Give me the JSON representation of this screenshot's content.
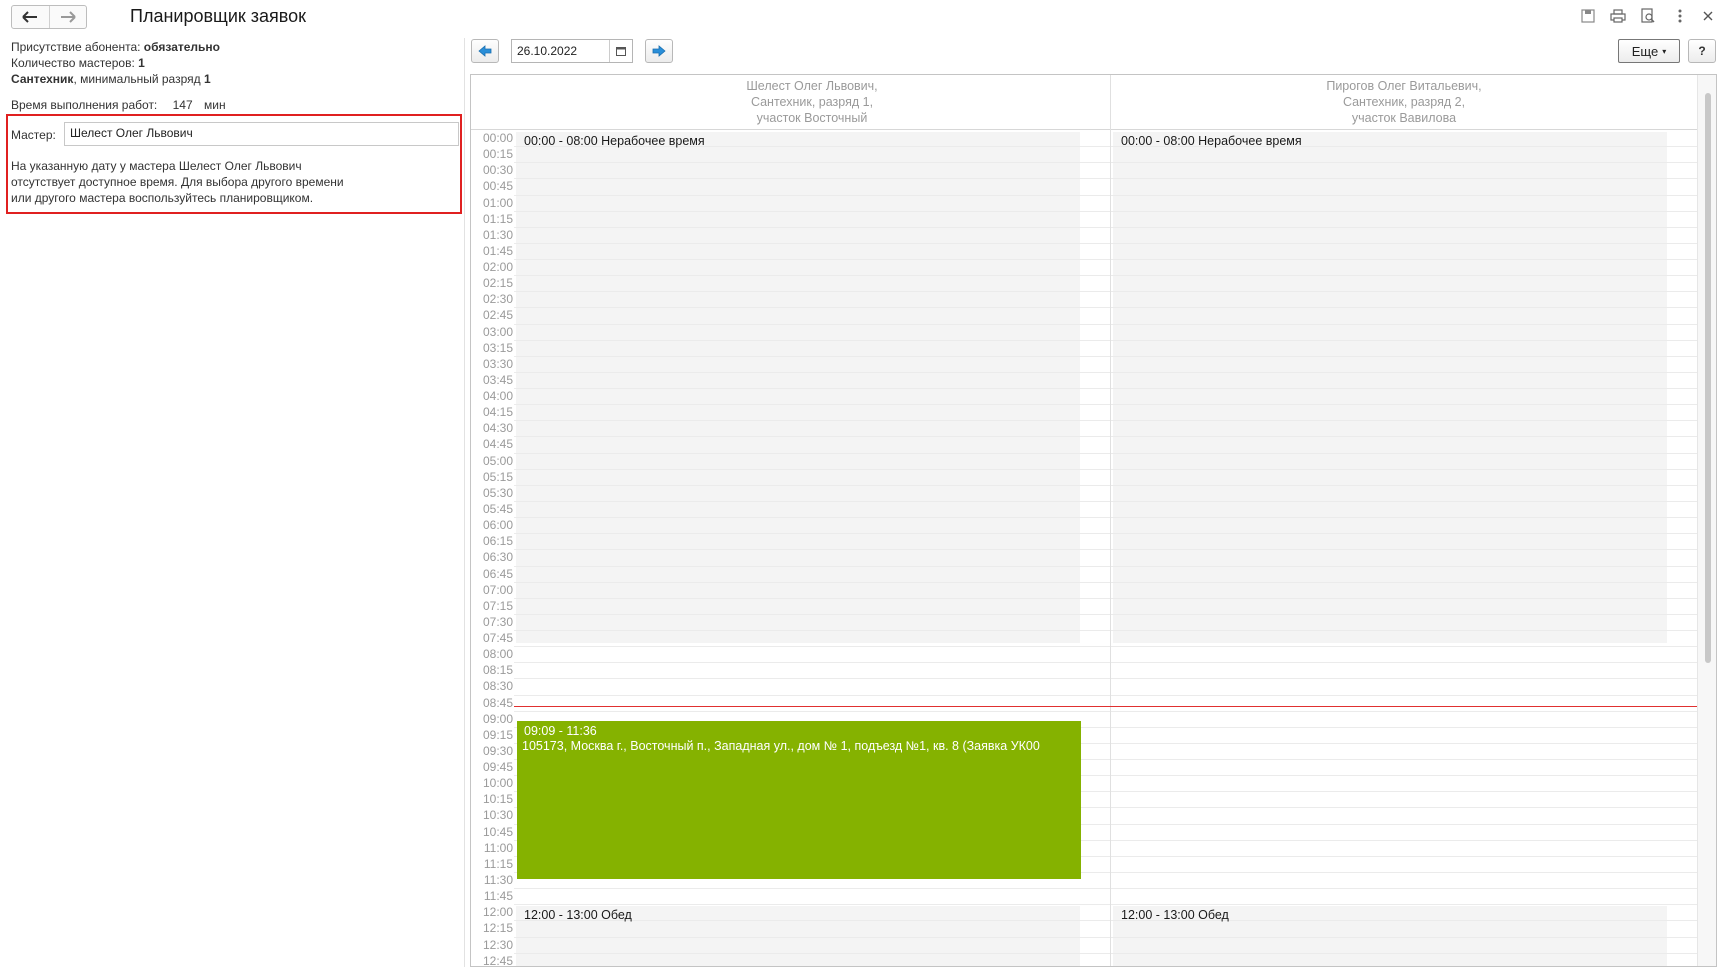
{
  "window": {
    "title": "Планировщик заявок"
  },
  "info": {
    "presence_label": "Присутствие абонента: ",
    "presence_value": "обязательно",
    "masters_count_label": "Количество мастеров: ",
    "masters_count_value": "1",
    "specialty_value": "Сантехник",
    "specialty_rest": ", минимальный разряд ",
    "specialty_grade": "1",
    "work_time_label": "Время выполнения работ:",
    "work_time_value": "147",
    "work_time_unit": "мин"
  },
  "master": {
    "label": "Мастер:",
    "value": "Шелест Олег Львович",
    "warning_line1": "На указанную дату у мастера Шелест Олег Львович",
    "warning_line2": "отсутствует доступное время. Для выбора другого времени",
    "warning_line3": "или другого мастера воспользуйтесь планировщиком."
  },
  "toolbar": {
    "date": "26.10.2022",
    "more_label": "Еще",
    "help_label": "?"
  },
  "columns": [
    {
      "line1": "Шелест Олег Львович,",
      "line2": "Сантехник, разряд 1,",
      "line3": "участок Восточный",
      "events": [
        {
          "kind": "off",
          "start": "00:00",
          "end": "08:00",
          "label": "00:00 - 08:00 Нерабочее время"
        },
        {
          "kind": "busy",
          "start": "09:09",
          "end": "11:36",
          "time_label": "09:09 - 11:36",
          "detail": "105173, Москва г., Восточный п., Западная ул., дом № 1, подъезд №1, кв. 8 (Заявка УК00"
        },
        {
          "kind": "off",
          "start": "12:00",
          "end": "13:00",
          "label": "12:00 - 13:00 Обед"
        }
      ]
    },
    {
      "line1": "Пирогов Олег Витальевич,",
      "line2": "Сантехник, разряд 2,",
      "line3": "участок Вавилова",
      "events": [
        {
          "kind": "off",
          "start": "00:00",
          "end": "08:00",
          "label": "00:00 - 08:00 Нерабочее время"
        },
        {
          "kind": "off",
          "start": "12:00",
          "end": "13:00",
          "label": "12:00 - 13:00 Обед"
        }
      ]
    }
  ],
  "current_time": "09:00",
  "time_slots": [
    "00:00",
    "00:15",
    "00:30",
    "00:45",
    "01:00",
    "01:15",
    "01:30",
    "01:45",
    "02:00",
    "02:15",
    "02:30",
    "02:45",
    "03:00",
    "03:15",
    "03:30",
    "03:45",
    "04:00",
    "04:15",
    "04:30",
    "04:45",
    "05:00",
    "05:15",
    "05:30",
    "05:45",
    "06:00",
    "06:15",
    "06:30",
    "06:45",
    "07:00",
    "07:15",
    "07:30",
    "07:45",
    "08:00",
    "08:15",
    "08:30",
    "08:45",
    "09:00",
    "09:15",
    "09:30",
    "09:45",
    "10:00",
    "10:15",
    "10:30",
    "10:45",
    "11:00",
    "11:15",
    "11:30",
    "11:45",
    "12:00",
    "12:15",
    "12:30",
    "12:45"
  ]
}
